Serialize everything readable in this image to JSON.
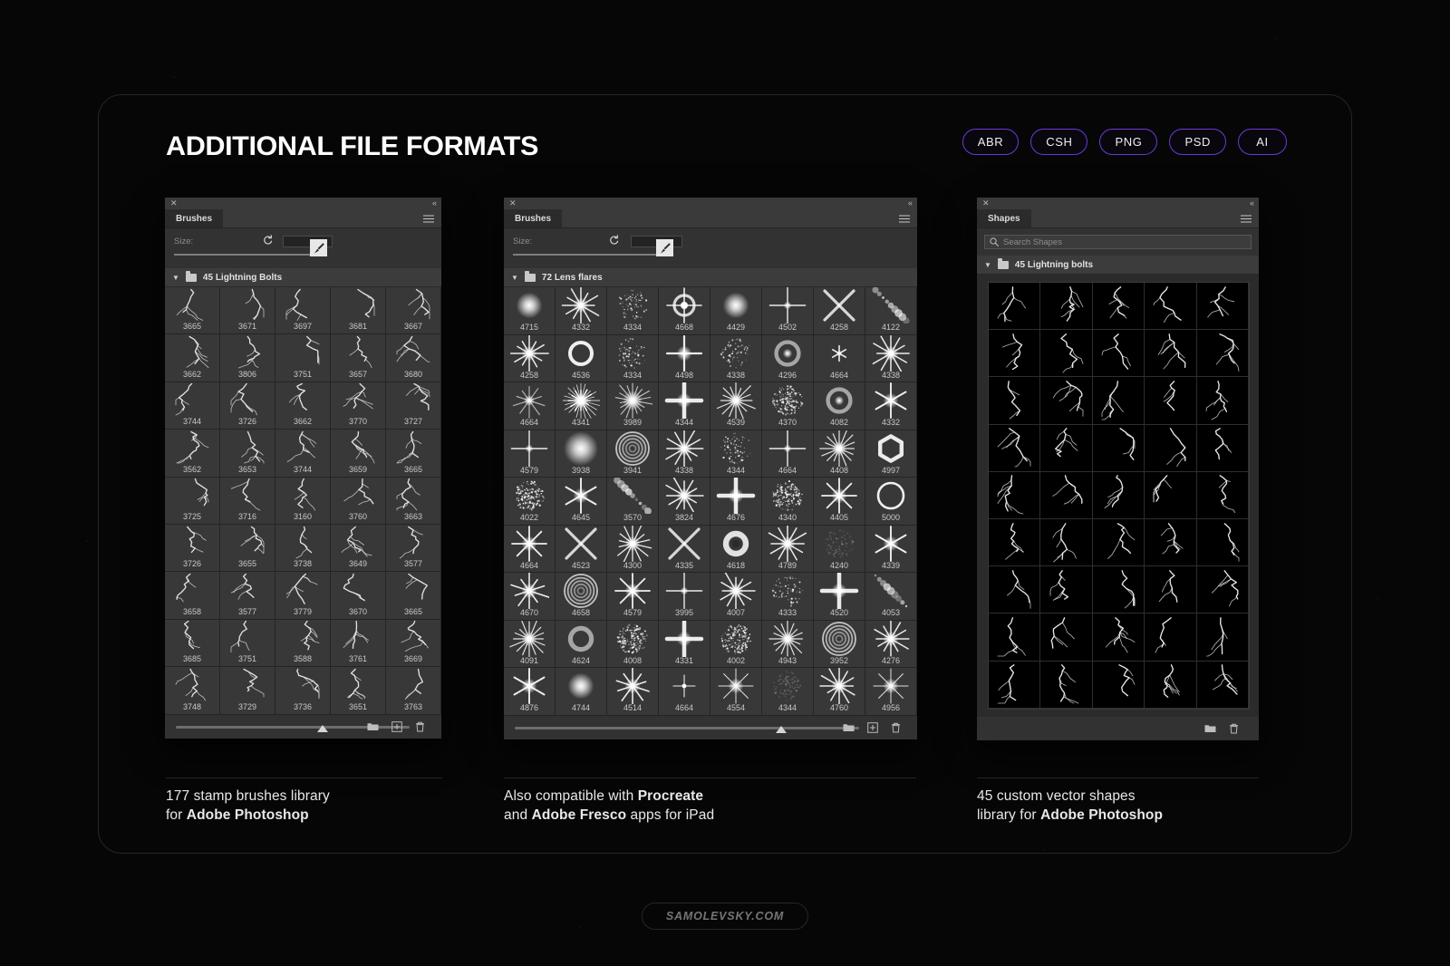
{
  "header": {
    "title": "ADDITIONAL FILE FORMATS",
    "badges": [
      "ABR",
      "CSH",
      "PNG",
      "PSD",
      "AI"
    ],
    "badge_border_color": "#6a3ad6"
  },
  "panels": [
    {
      "id": "brushes-lightning",
      "tab_label": "Brushes",
      "close_icon": "close-icon",
      "collapse_icon": "collapse-icon",
      "menu_icon": "panel-menu-icon",
      "size_label": "Size:",
      "size_value": "",
      "reset_icon": "reset-icon",
      "brush_icon": "brush-icon",
      "folder_label": "45 Lightning Bolts",
      "columns": 5,
      "thumb_kind": "lightning",
      "items": [
        "3665",
        "3671",
        "3697",
        "3681",
        "3667",
        "3662",
        "3806",
        "3751",
        "3657",
        "3680",
        "3744",
        "3726",
        "3662",
        "3770",
        "3727",
        "3562",
        "3653",
        "3744",
        "3659",
        "3665",
        "3725",
        "3716",
        "3160",
        "3760",
        "3663",
        "3726",
        "3655",
        "3738",
        "3649",
        "3577",
        "3658",
        "3577",
        "3779",
        "3670",
        "3665",
        "3685",
        "3751",
        "3588",
        "3761",
        "3669",
        "3748",
        "3729",
        "3736",
        "3651",
        "3763"
      ],
      "bottom_icons": [
        "folder-icon",
        "new-brush-icon",
        "trash-icon"
      ]
    },
    {
      "id": "brushes-lensflares",
      "tab_label": "Brushes",
      "close_icon": "close-icon",
      "collapse_icon": "collapse-icon",
      "menu_icon": "panel-menu-icon",
      "size_label": "Size:",
      "size_value": "",
      "reset_icon": "reset-icon",
      "brush_icon": "brush-icon",
      "folder_label": "72 Lens flares",
      "columns": 8,
      "thumb_kind": "flare",
      "items": [
        "4715",
        "4332",
        "4334",
        "4668",
        "4429",
        "4502",
        "4258",
        "4122",
        "4258",
        "4536",
        "4334",
        "4498",
        "4338",
        "4296",
        "4664",
        "4338",
        "4664",
        "4341",
        "3989",
        "4344",
        "4539",
        "4370",
        "4082",
        "4332",
        "4579",
        "3938",
        "3941",
        "4338",
        "4344",
        "4664",
        "4408",
        "4997",
        "4022",
        "4645",
        "3570",
        "3824",
        "4676",
        "4340",
        "4405",
        "5000",
        "4664",
        "4523",
        "4300",
        "4335",
        "4618",
        "4789",
        "4240",
        "4339",
        "4670",
        "4658",
        "4579",
        "3995",
        "4007",
        "4333",
        "4520",
        "4053",
        "4091",
        "4624",
        "4008",
        "4331",
        "4002",
        "4943",
        "3952",
        "4276",
        "4876",
        "4744",
        "4514",
        "4664",
        "4554",
        "4344",
        "4760",
        "4956"
      ],
      "flare_styles": [
        "glow",
        "star12",
        "speck",
        "ring-star",
        "glow",
        "star4-thin",
        "x-beam",
        "bokeh-chain",
        "star12",
        "ring",
        "speck",
        "star4",
        "speck",
        "ring-thick",
        "small-star",
        "star12",
        "star-soft",
        "star-burst",
        "glow-star",
        "star4-fat",
        "star16",
        "speck-dense",
        "ring-thick",
        "star6",
        "star4-thin",
        "glow-big",
        "rings",
        "star12",
        "speck",
        "star4-thin",
        "star16",
        "hexagon",
        "speck-dense",
        "star6",
        "bokeh-chain",
        "star12",
        "star4-fat",
        "speck-dense",
        "star8",
        "ring-big",
        "star8",
        "x-beam",
        "star14",
        "x-beam",
        "donut",
        "star12",
        "speck-faint",
        "star6",
        "star10",
        "rings3",
        "star8",
        "star4-thin",
        "star12",
        "speck",
        "star4-fat",
        "bokeh-chain",
        "star16",
        "donut-soft",
        "speck-dense",
        "star4-fat",
        "speck-dense",
        "star16",
        "rings",
        "star12",
        "star6",
        "glow",
        "star10",
        "star4-tiny",
        "star8-thin",
        "speck-faint",
        "star12",
        "star8-thin"
      ],
      "bottom_icons": [
        "folder-icon",
        "new-brush-icon",
        "trash-icon"
      ]
    },
    {
      "id": "shapes-lightning",
      "tab_label": "Shapes",
      "close_icon": "close-icon",
      "collapse_icon": "collapse-icon",
      "menu_icon": "panel-menu-icon",
      "search_placeholder": "Search Shapes",
      "search_value": "",
      "search_icon": "search-icon",
      "folder_label": "45 Lightning bolts",
      "columns": 5,
      "rows": 9,
      "thumb_kind": "lightning-shape",
      "bottom_icons": [
        "folder-icon",
        "trash-icon"
      ]
    }
  ],
  "captions": [
    {
      "line1_plain": "177 stamp brushes library",
      "line2_plain": "for ",
      "line2_bold": "Adobe Photoshop",
      "line2_tail": ""
    },
    {
      "line1_plain": "Also compatible with  ",
      "line1_bold": "Procreate",
      "line2_plain": "and ",
      "line2_bold": "Adobe Fresco",
      "line2_tail": " apps for iPad"
    },
    {
      "line1_plain": "45 custom vector shapes",
      "line2_plain": "library for ",
      "line2_bold": "Adobe Photoshop",
      "line2_tail": ""
    }
  ],
  "footer": {
    "watermark": "SAMOLEVSKY.COM"
  }
}
